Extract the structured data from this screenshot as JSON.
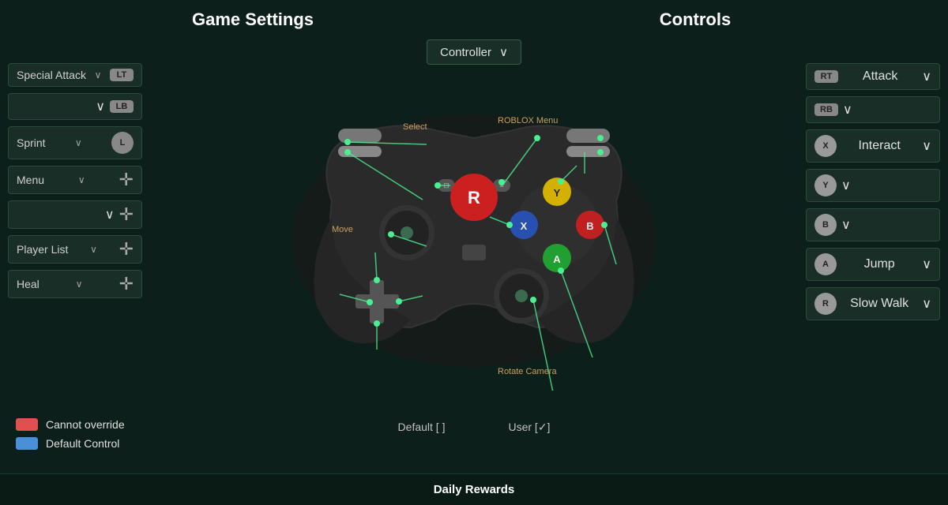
{
  "header": {
    "left_title": "Game Settings",
    "right_title": "Controls"
  },
  "controller_dropdown": {
    "label": "Controller",
    "chevron": "∨"
  },
  "left_panel": {
    "items": [
      {
        "id": "special-attack",
        "label": "Special Attack",
        "badge": "LT",
        "has_label": true
      },
      {
        "id": "lb-empty",
        "label": "",
        "badge": "LB",
        "has_label": false
      },
      {
        "id": "sprint",
        "label": "Sprint",
        "badge": "L",
        "circle": true,
        "has_label": true
      },
      {
        "id": "menu",
        "label": "Menu",
        "badge": "D1",
        "dpad": true,
        "has_label": true
      },
      {
        "id": "dpad-empty",
        "label": "",
        "badge": "D2",
        "dpad": true,
        "has_label": false
      },
      {
        "id": "player-list",
        "label": "Player List",
        "badge": "D3",
        "dpad": true,
        "has_label": true
      },
      {
        "id": "heal",
        "label": "Heal",
        "badge": "D4",
        "dpad": true,
        "has_label": true
      }
    ]
  },
  "right_panel": {
    "items": [
      {
        "id": "attack",
        "label": "Attack",
        "badge": "RT",
        "has_label": true
      },
      {
        "id": "rb-empty",
        "label": "",
        "badge": "RB",
        "has_label": false
      },
      {
        "id": "interact",
        "label": "Interact",
        "badge": "X",
        "circle": true,
        "has_label": true
      },
      {
        "id": "y-empty",
        "label": "",
        "badge": "Y",
        "circle": true,
        "has_label": false
      },
      {
        "id": "b-empty",
        "label": "",
        "badge": "B",
        "circle": true,
        "has_label": false
      },
      {
        "id": "jump",
        "label": "Jump",
        "badge": "A",
        "circle": true,
        "has_label": true
      },
      {
        "id": "slow-walk",
        "label": "Slow Walk",
        "badge": "R",
        "circle": true,
        "has_label": true
      }
    ]
  },
  "controller_labels": {
    "select": "Select",
    "roblox_menu": "ROBLOX Menu",
    "move": "Move",
    "rotate_camera": "Rotate Camera"
  },
  "legend": {
    "cannot_override": {
      "color": "#e05050",
      "text": "Cannot override"
    },
    "default_control": {
      "color": "#4a90d9",
      "text": "Default Control"
    }
  },
  "bottom_labels": {
    "default": "Default [ ]",
    "user": "User [✓]"
  },
  "footer": {
    "daily_rewards": "Daily Rewards"
  },
  "buttons": {
    "y_color": "#e0c030",
    "x_color": "#4070d0",
    "b_color": "#d03030",
    "a_color": "#30a040",
    "roblox_red": "#cc2020"
  }
}
